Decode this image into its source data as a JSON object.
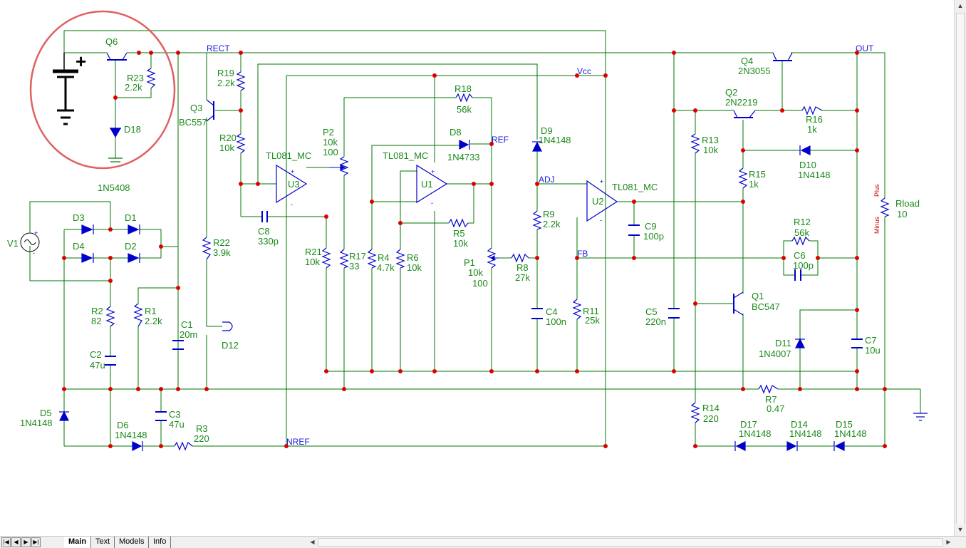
{
  "tabs": [
    {
      "label": "Main",
      "active": true
    },
    {
      "label": "Text",
      "active": false
    },
    {
      "label": "Models",
      "active": false
    },
    {
      "label": "Info",
      "active": false
    }
  ],
  "nav_buttons": [
    "|◀",
    "◀",
    "▶",
    "▶|"
  ],
  "nodes": {
    "rect": "RECT",
    "vcc": "Vcc",
    "out": "OUT",
    "ref": "REF",
    "adj": "ADJ",
    "fb": "FB",
    "nref": "NREF"
  },
  "supply_symbol": {
    "polarity": "+"
  },
  "highlight_circle_color": "#e06060",
  "wire_color": "#007700",
  "component_color": "#0000cc",
  "node_dot_color": "#dd0000",
  "components": {
    "q6": {
      "name": "Q6"
    },
    "r23": {
      "name": "R23",
      "value": "2.2k"
    },
    "d18": {
      "name": "D18"
    },
    "d18_part": {
      "value": "1N5408"
    },
    "v1": {
      "name": "V1"
    },
    "d3": {
      "name": "D3"
    },
    "d1": {
      "name": "D1"
    },
    "d4": {
      "name": "D4"
    },
    "d2": {
      "name": "D2"
    },
    "r2": {
      "name": "R2",
      "value": "82"
    },
    "r1": {
      "name": "R1",
      "value": "2.2k"
    },
    "c2": {
      "name": "C2",
      "value": "47u"
    },
    "c1": {
      "name": "C1",
      "value": "20m"
    },
    "d5": {
      "name": "D5",
      "value": "1N4148"
    },
    "d6": {
      "name": "D6",
      "value": "1N4148"
    },
    "c3": {
      "name": "C3",
      "value": "47u"
    },
    "r3": {
      "name": "R3",
      "value": "220"
    },
    "q3": {
      "name": "Q3",
      "value": "BC557"
    },
    "r19": {
      "name": "R19",
      "value": "2.2k"
    },
    "r20": {
      "name": "R20",
      "value": "10k"
    },
    "r22": {
      "name": "R22",
      "value": "3.9k"
    },
    "d12": {
      "name": "D12"
    },
    "u3": {
      "name": "U3",
      "value": "TL081_MC"
    },
    "c8": {
      "name": "C8",
      "value": "330p"
    },
    "r21": {
      "name": "R21",
      "value": "10k"
    },
    "p2": {
      "name": "P2",
      "value": "10k",
      "value2": "100"
    },
    "r17": {
      "name": "R17",
      "value": "33"
    },
    "r18": {
      "name": "R18",
      "value": "56k"
    },
    "d8": {
      "name": "D8",
      "value": "1N4733"
    },
    "u1": {
      "name": "U1",
      "value": "TL081_MC"
    },
    "r4": {
      "name": "R4",
      "value": "4.7k"
    },
    "r6": {
      "name": "R6",
      "value": "10k"
    },
    "r5": {
      "name": "R5",
      "value": "10k"
    },
    "p1": {
      "name": "P1",
      "value": "10k",
      "value2": "100"
    },
    "r8": {
      "name": "R8",
      "value": "27k"
    },
    "d9": {
      "name": "D9",
      "value": "1N4148"
    },
    "r9": {
      "name": "R9",
      "value": "2.2k"
    },
    "c4": {
      "name": "C4",
      "value": "100n"
    },
    "u2": {
      "name": "U2",
      "value": "TL081_MC"
    },
    "c9": {
      "name": "C9",
      "value": "100p"
    },
    "r11": {
      "name": "R11",
      "value": "25k"
    },
    "c5": {
      "name": "C5",
      "value": "220n"
    },
    "q4": {
      "name": "Q4",
      "value": "2N3055"
    },
    "q2": {
      "name": "Q2",
      "value": "2N2219"
    },
    "r16": {
      "name": "R16",
      "value": "1k"
    },
    "r13": {
      "name": "R13",
      "value": "10k"
    },
    "r15": {
      "name": "R15",
      "value": "1k"
    },
    "d10": {
      "name": "D10",
      "value": "1N4148"
    },
    "r12": {
      "name": "R12",
      "value": "56k"
    },
    "c6": {
      "name": "C6",
      "value": "100p"
    },
    "q1": {
      "name": "Q1",
      "value": "BC547"
    },
    "d11": {
      "name": "D11",
      "value": "1N4007"
    },
    "c7": {
      "name": "C7",
      "value": "10u"
    },
    "r7": {
      "name": "R7",
      "value": "0.47"
    },
    "r14": {
      "name": "R14",
      "value": "220"
    },
    "d17": {
      "name": "D17",
      "value": "1N4148"
    },
    "d14": {
      "name": "D14",
      "value": "1N4148"
    },
    "d15": {
      "name": "D15",
      "value": "1N4148"
    },
    "rload": {
      "name": "Rload",
      "value": "10"
    }
  },
  "meter_labels": {
    "plus": "Plus",
    "minus": "Minus"
  }
}
